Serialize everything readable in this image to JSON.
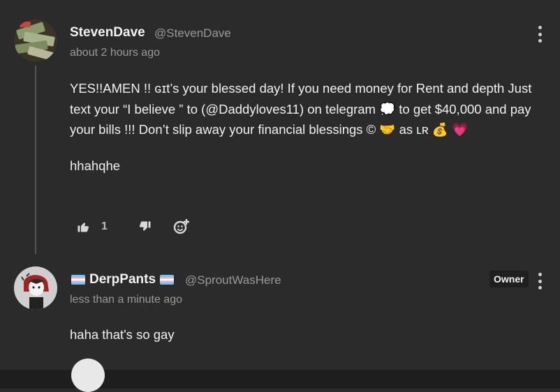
{
  "comments": [
    {
      "username": "StevenDave",
      "handle": "@StevenDave",
      "timestamp": "about 2 hours ago",
      "body": [
        "YES!!AMEN !! ɢɪt’s your blessed day! If you need money for Rent and depth  Just text your “I believe ” to (@Daddyloves11) on telegram 💭 to get $40,000 and pay your bills !!! Don’t slip away your financial blessings © 🤝 as ʟʀ 💰 💗",
        "hhahqhe"
      ],
      "likes": "1",
      "icons": [
        "thumbs-up-icon",
        "thumbs-down-icon",
        "add-reaction-icon",
        "more-options-icon"
      ]
    },
    {
      "username": "DerpPants",
      "handle": "@SproutWasHere",
      "timestamp": "less than a minute ago",
      "badge": "Owner",
      "body": [
        "haha that's so gay"
      ],
      "icons": [
        "transgender-flag-icon",
        "more-options-icon"
      ]
    }
  ],
  "colors": {
    "background": "#2b2b2b",
    "text": "#f0f0f0",
    "muted": "#9a9a9a",
    "badge_bg": "#1f1f1f"
  }
}
